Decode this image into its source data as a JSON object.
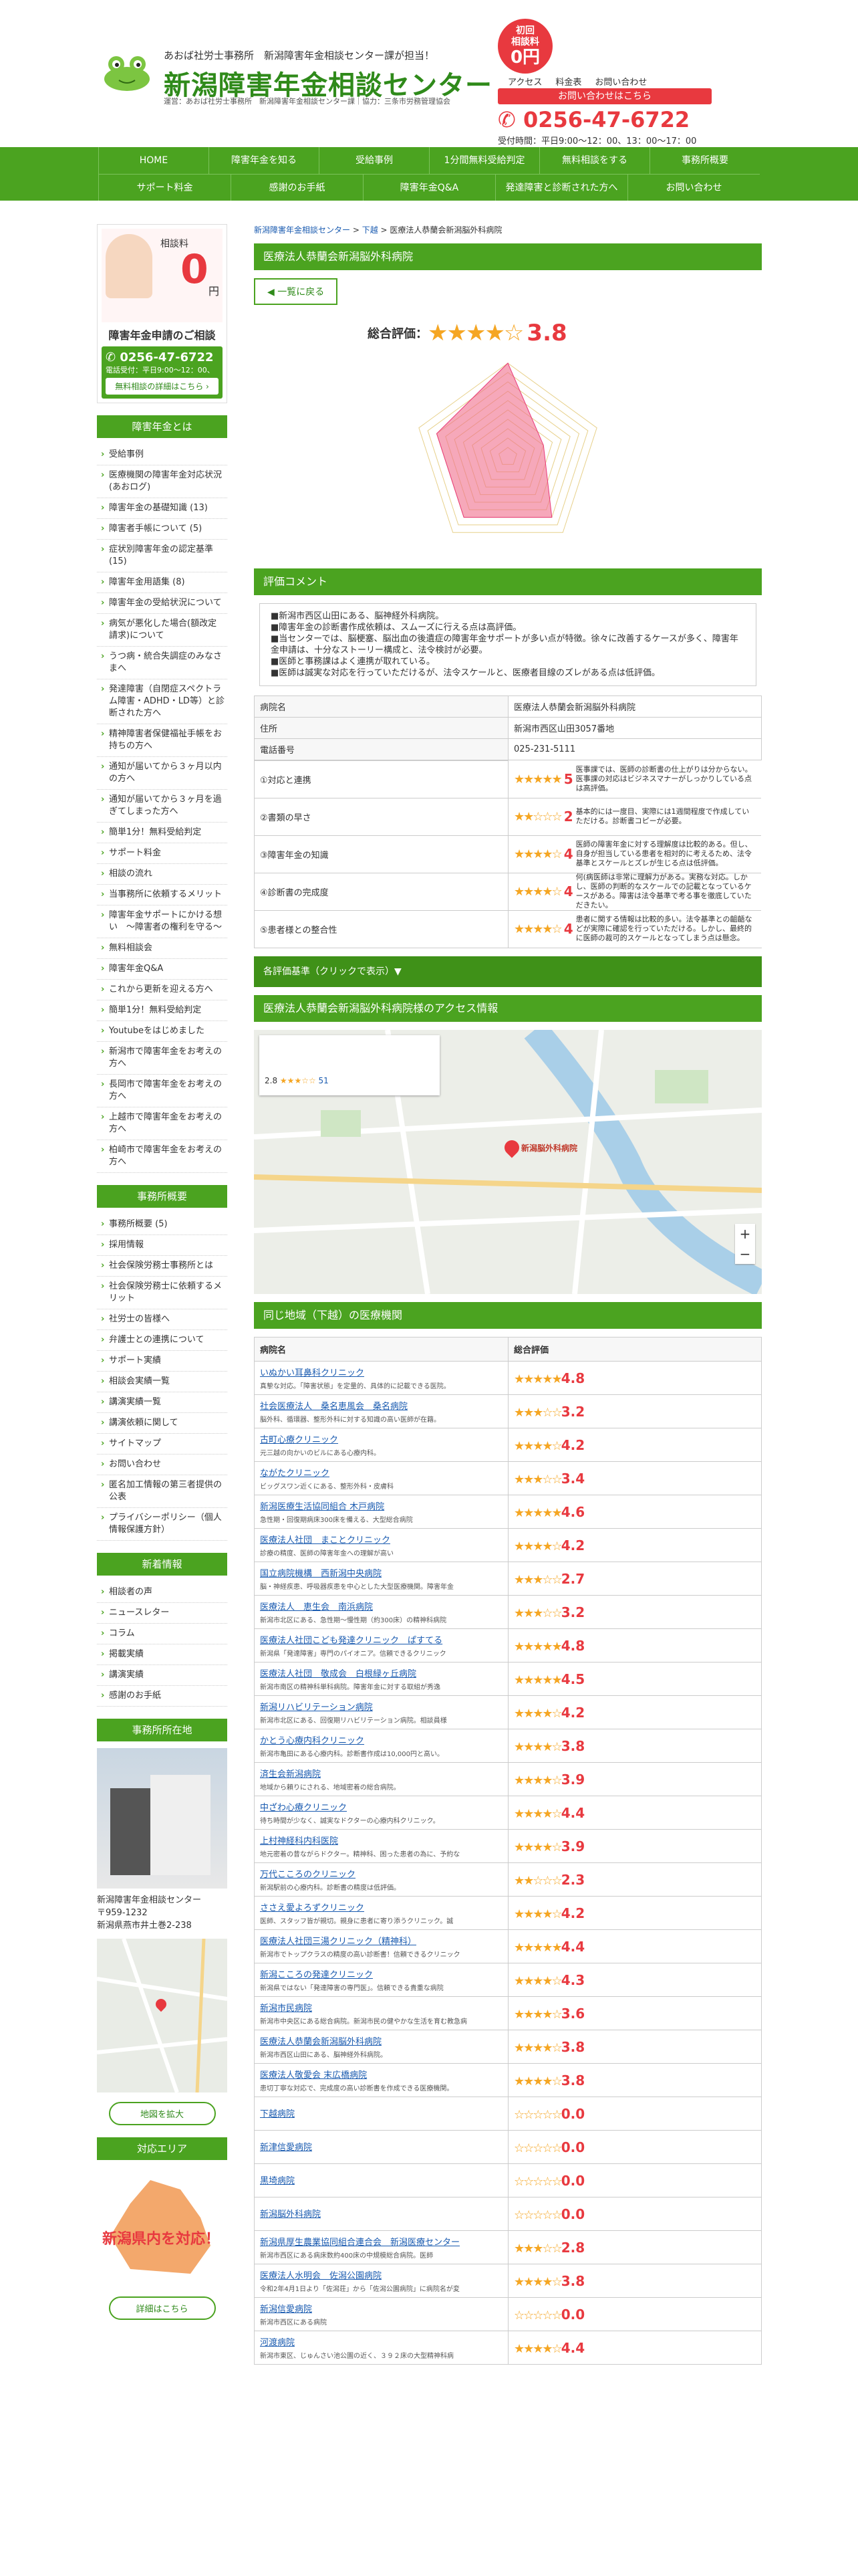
{
  "header": {
    "tagline": "あおば社労士事務所　新潟障害年金相談センター課が担当！",
    "title": "新潟障害年金相談センター",
    "sub": "運営：あおば社労士事務所　新潟障害年金相談センター課｜協力：三条市労務管理協会",
    "badge_top": "初回\n相談料",
    "badge_zero": "0円",
    "nav": [
      "アクセス",
      "料金表",
      "お問い合わせ"
    ],
    "cta": "お問い合わせはこちら",
    "phone": "0256-47-6722",
    "hours": "受付時間：平日9:00～12：00、13：00～17：00"
  },
  "nav": {
    "row1": [
      "HOME",
      "障害年金を知る",
      "受給事例",
      "1分間無料受給判定",
      "無料相談をする",
      "事務所概要"
    ],
    "row2": [
      "サポート料金",
      "感謝のお手紙",
      "障害年金Q&A",
      "発達障害と診断された方へ",
      "お問い合わせ"
    ]
  },
  "sidebar": {
    "free_label": "相談料",
    "zero": "0",
    "yen": "円",
    "guide": "障害年金申請のご相談",
    "tel": "0256-47-6722",
    "hr": "電話受付：平日9:00～12：00、",
    "detail": "無料相談の詳細はこちら ›",
    "sec1": "障害年金とは",
    "list1": [
      "受給事例",
      "医療機関の障害年金対応状況(あおログ)",
      "障害年金の基礎知識 (13)",
      "障害者手帳について (5)",
      "症状別障害年金の認定基準 (15)",
      "障害年金用語集 (8)",
      "障害年金の受給状況について",
      "病気が悪化した場合(額改定請求)について",
      "うつ病・統合失調症のみなさまへ",
      "発達障害（自閉症スペクトラム障害・ADHD・LD等）と診断された方へ",
      "精神障害者保健福祉手帳をお持ちの方へ",
      "通知が届いてから３ヶ月以内の方へ",
      "通知が届いてから３ヶ月を過ぎてしまった方へ",
      "簡単1分！無料受給判定",
      "サポート料金",
      "相談の流れ",
      "当事務所に依頼するメリット",
      "障害年金サポートにかける想い　〜障害者の権利を守る〜",
      "無料相談会",
      "障害年金Q&A",
      "これから更新を迎える方へ",
      "簡単1分！無料受給判定",
      "Youtubeをはじめました",
      "新潟市で障害年金をお考えの方へ",
      "長岡市で障害年金をお考えの方へ",
      "上越市で障害年金をお考えの方へ",
      "柏崎市で障害年金をお考えの方へ"
    ],
    "sec2": "事務所概要",
    "list2": [
      "事務所概要 (5)",
      "採用情報",
      "社会保険労務士事務所とは",
      "社会保険労務士に依頼するメリット",
      "社労士の皆様へ",
      "弁護士との連携について",
      "サポート実績",
      "相談会実績一覧",
      "講演実績一覧",
      "講演依頼に関して",
      "サイトマップ",
      "お問い合わせ",
      "匿名加工情報の第三者提供の公表",
      "プライバシーポリシー（個人情報保護方針）"
    ],
    "sec3": "新着情報",
    "list3": [
      "相談者の声",
      "ニュースレター",
      "コラム",
      "掲載実績",
      "講演実績",
      "感謝のお手紙"
    ],
    "sec4": "事務所所在地",
    "office": "新潟障害年金相談センター",
    "zip": "〒959-1232",
    "addr": "新潟県燕市井土巻2-238",
    "zoom": "地図を拡大",
    "sec5": "対応エリア",
    "area": "新潟県内を対応！",
    "area_btn": "詳細はこちら"
  },
  "main": {
    "crumb_home": "新潟障害年金相談センター",
    "crumb_mid": "下越",
    "crumb_cur": "医療法人恭蘭会新潟脳外科病院",
    "h_hosp": "医療法人恭蘭会新潟脳外科病院",
    "back": "一覧に戻る",
    "overall_label": "総合評価：",
    "overall_stars": "★★★★☆",
    "overall_score": "3.8",
    "h_comment": "評価コメント",
    "comments": [
      "■新潟市西区山田にある、脳神経外科病院。",
      "■障害年金の診断書作成依頼は、スムーズに行える点は高評価。",
      "■当センターでは、脳梗塞、脳出血の後遺症の障害年金サポートが多い点が特徴。徐々に改善するケースが多く、障害年金申請は、十分なストーリー構成と、法令検討が必要。",
      "■医師と事務課はよく連携が取れている。",
      "■医師は誠実な対応を行っていただけるが、法令スケールと、医療者目線のズレがある点は低評価。"
    ],
    "info": [
      [
        "病院名",
        "医療法人恭蘭会新潟脳外科病院"
      ],
      [
        "住所",
        "新潟市西区山田3057番地"
      ],
      [
        "電話番号",
        "025-231-5111"
      ]
    ],
    "eval": [
      {
        "label": "①対応と連携",
        "stars": "★★★★★",
        "score": "5",
        "desc": "医事課では、医師の診断書の仕上がりは分からない。医事課の対応はビジネスマナーがしっかりしている点は高評価。"
      },
      {
        "label": "②書類の早さ",
        "stars": "★★☆☆☆",
        "score": "2",
        "desc": "基本的には一度目、実際には1週間程度で作成していただける。診断書コピーが必要。"
      },
      {
        "label": "③障害年金の知識",
        "stars": "★★★★☆",
        "score": "4",
        "desc": "医師の障害年金に対する理解度は比較的ある。但し、自身が担当している患者を相対的に考えるため、法令基準とスケールとズレが生じる点は低評価。"
      },
      {
        "label": "④診断書の完成度",
        "stars": "★★★★☆",
        "score": "4",
        "desc": "何(病医師は非常に理解力がある。実務な対応。しかし、医師の判断的なスケールでの記載となっているケースがある。障害は法令基準で考る事を徹底していただきたい。"
      },
      {
        "label": "⑤患者様との整合性",
        "stars": "★★★★☆",
        "score": "4",
        "desc": "患者に関する情報は比較的多い。法令基準との齟齬などが実際に確認を行っていただける。しかし、最終的に医師の裁可的スケールとなってしまう点は懸念。"
      }
    ],
    "toggle": "各評価基準（クリックで表示）▼",
    "h_access": "医療法人恭蘭会新潟脳外科病院様のアクセス情報",
    "map_rating": "2.8",
    "map_reviews": "51",
    "map_pin": "新潟脳外科病院",
    "h_near": "同じ地域（下越）の医療機関",
    "near_head": [
      "病院名",
      "総合評価"
    ],
    "near": [
      [
        "いぬかい耳鼻科クリニック",
        "真摯な対応。「障害状態」を定量的、具体的に記載できる医院。",
        "★★★★★",
        "4.8"
      ],
      [
        "社会医療法人　桑名恵風会　桑名病院",
        "脳外科、循環器、整形外科に対する知識の高い医師が在籍。",
        "★★★☆☆",
        "3.2"
      ],
      [
        "古町心療クリニック",
        "元三越の向かいのビルにある心療内科。",
        "★★★★☆",
        "4.2"
      ],
      [
        "ながたクリニック",
        "ビッグスワン近くにある、整形外科・皮膚科",
        "★★★☆☆",
        "3.4"
      ],
      [
        "新潟医療生活協同組合 木戸病院",
        "急性期・回復期病床300床を備える、大型総合病院",
        "★★★★★",
        "4.6"
      ],
      [
        "医療法人社団　まことクリニック",
        "診療の精度、医師の障害年金への理解が高い",
        "★★★★☆",
        "4.2"
      ],
      [
        "国立病院機構　西新潟中央病院",
        "脳・神経疾患、呼吸器疾患を中心とした大型医療機関。障害年金",
        "★★★☆☆",
        "2.7"
      ],
      [
        "医療法人　恵生会　南浜病院",
        "新潟市北区にある、急性期〜慢性期（約300床）の精神科病院",
        "★★★☆☆",
        "3.2"
      ],
      [
        "医療法人社団こども発達クリニック　ぱすてる",
        "新潟県「発達障害」専門のパイオニア。信頼できるクリニック",
        "★★★★★",
        "4.8"
      ],
      [
        "医療法人社団　敬成会　白根緑ヶ丘病院",
        "新潟市南区の精神科単科病院。障害年金に対する取組が秀逸",
        "★★★★★",
        "4.5"
      ],
      [
        "新潟リハビリテーション病院",
        "新潟市北区にある、回復期リハビリテーション病院。相談員様",
        "★★★★☆",
        "4.2"
      ],
      [
        "かとう心療内科クリニック",
        "新潟市亀田にある心療内科。診断書作成は10,000円と高い。",
        "★★★★☆",
        "3.8"
      ],
      [
        "済生会新潟病院",
        "地域から頼りにされる、地域密着の総合病院。",
        "★★★★☆",
        "3.9"
      ],
      [
        "中ざわ心療クリニック",
        "待ち時間が少なく、誠実なドクターの心療内科クリニック。",
        "★★★★☆",
        "4.4"
      ],
      [
        "上村神経科内科医院",
        "地元密着の昔ながらドクター。精神科、困った患者の為に、予約な",
        "★★★★☆",
        "3.9"
      ],
      [
        "万代こころのクリニック",
        "新潟駅前の心療内科。診断書の精度は低評価。",
        "★★☆☆☆",
        "2.3"
      ],
      [
        "ささえ愛よろずクリニック",
        "医師、スタッフ皆が親切。親身に患者に寄り添うクリニック。誠",
        "★★★★☆",
        "4.2"
      ],
      [
        "医療法人社団三湯クリニック（精神科）",
        "新潟市でトップクラスの精度の高い診断書！信頼できるクリニック",
        "★★★★★",
        "4.4"
      ],
      [
        "新潟こころの発達クリニック",
        "新潟県ではない「発達障害の専門医」。信頼できる貴重な病院",
        "★★★★☆",
        "4.3"
      ],
      [
        "新潟市民病院",
        "新潟市中央区にある総合病院。新潟市民の健やかな生活を育む教急病",
        "★★★★☆",
        "3.6"
      ],
      [
        "医療法人恭蘭会新潟脳外科病院",
        "新潟市西区山田にある、脳神経外科病院。",
        "★★★★☆",
        "3.8"
      ],
      [
        "医療法人敬愛会 末広橋病院",
        "患切丁寧な対応で、完成度の高い診断書を作成できる医療機関。",
        "★★★★☆",
        "3.8"
      ],
      [
        "下越病院",
        "",
        "☆☆☆☆☆",
        "0.0"
      ],
      [
        "新津信愛病院",
        "",
        "☆☆☆☆☆",
        "0.0"
      ],
      [
        "黒埼病院",
        "",
        "☆☆☆☆☆",
        "0.0"
      ],
      [
        "新潟脳外科病院",
        "",
        "☆☆☆☆☆",
        "0.0"
      ],
      [
        "新潟県厚生農業協同組合連合会　新潟医療センター",
        "新潟市西区にある病床数約400床の中規模総合病院。医師",
        "★★★☆☆",
        "2.8"
      ],
      [
        "医療法人水明会　佐潟公園病院",
        "令和2年4月1日より「佐潟荘」から「佐潟公園病院」に病院名が変",
        "★★★★☆",
        "3.8"
      ],
      [
        "新潟信愛病院",
        "新潟市西区にある病院",
        "☆☆☆☆☆",
        "0.0"
      ],
      [
        "河渡病院",
        "新潟市東区、じゅんさい池公園の近く、３９２床の大型精神科病",
        "★★★★☆",
        "4.4"
      ]
    ]
  }
}
